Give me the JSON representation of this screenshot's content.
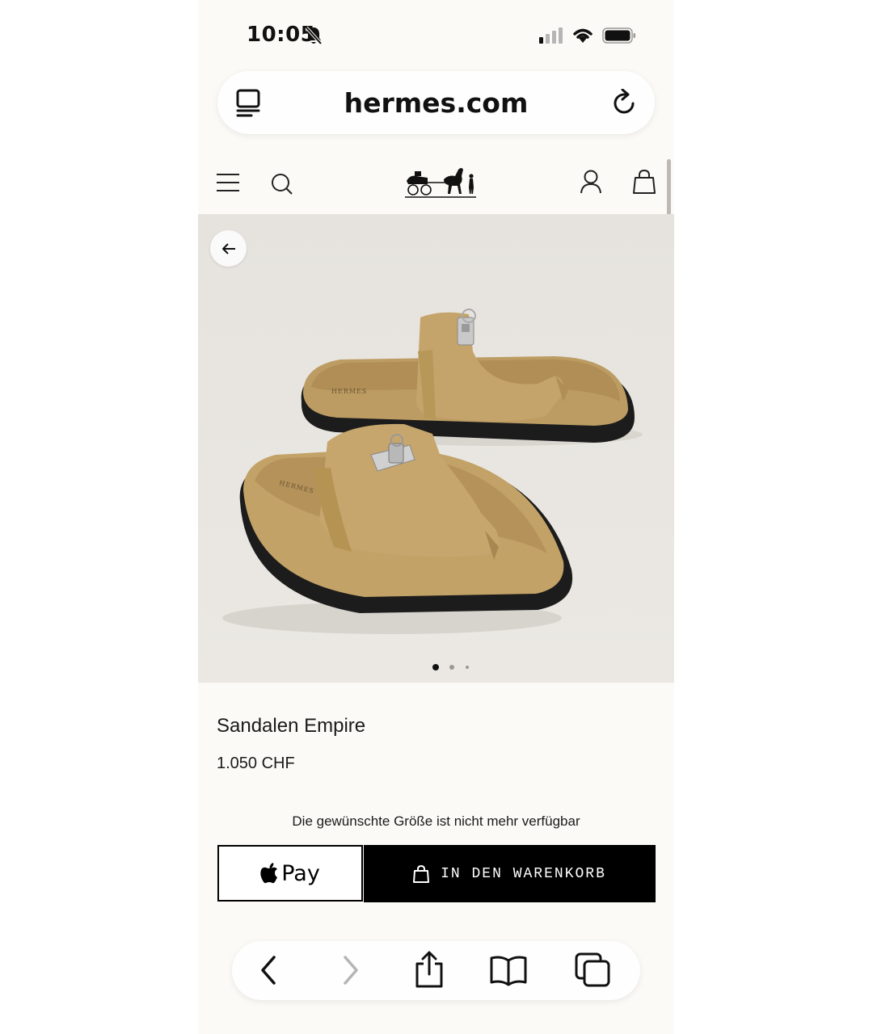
{
  "status_bar": {
    "time": "10:05"
  },
  "browser": {
    "url": "hermes.com"
  },
  "product": {
    "name": "Sandalen Empire",
    "price": "1.050 CHF",
    "availability_note": "Die gewünschte Größe ist nicht mehr verfügbar",
    "image_carousel": {
      "count": 3,
      "active_index": 1
    }
  },
  "actions": {
    "apple_pay_label": "Pay",
    "add_to_cart_label": "IN DEN WARENKORB"
  },
  "colors": {
    "page_background": "#fcfaf6",
    "image_background": "#e8e5e0",
    "sandal_suede": "#c3a46a",
    "sole": "#1c1c1c",
    "button_black": "#000000"
  },
  "icons": [
    "bell-off-icon",
    "signal-icon",
    "wifi-icon",
    "battery-icon",
    "tabs-icon",
    "reload-icon",
    "menu-icon",
    "search-icon",
    "account-icon",
    "shopping-bag-icon",
    "arrow-left-icon",
    "apple-logo-icon",
    "back-icon",
    "forward-icon",
    "share-icon",
    "bookmarks-icon",
    "tab-overview-icon"
  ]
}
